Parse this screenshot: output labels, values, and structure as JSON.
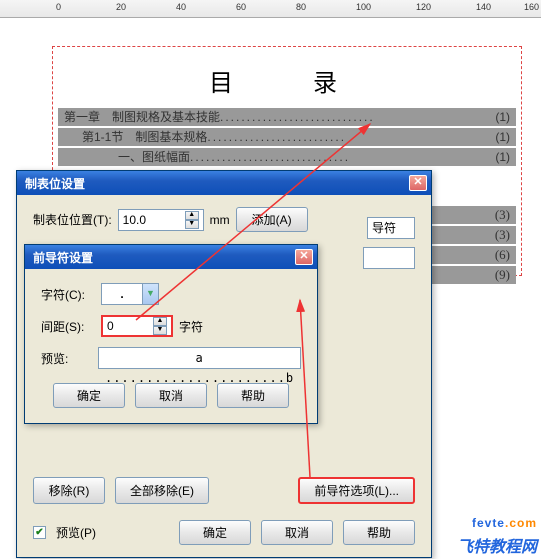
{
  "ruler": {
    "marks": [
      "0",
      "20",
      "40",
      "60",
      "80",
      "100",
      "120",
      "140",
      "160"
    ]
  },
  "doc": {
    "title": "目　录",
    "toc": [
      {
        "label": "第一章　制图规格及基本技能",
        "page": "(1)",
        "indent": 0
      },
      {
        "label": "第1-1节　制图基本规格",
        "page": "(1)",
        "indent": 1
      },
      {
        "label": "一、图纸幅面",
        "page": "(1)",
        "indent": 2
      }
    ],
    "hidden_pages": [
      "(3)",
      "(3)",
      "(6)",
      "(9)"
    ]
  },
  "main_dialog": {
    "title": "制表位设置",
    "pos_label": "制表位位置(T):",
    "pos_value": "10.0",
    "pos_unit": "mm",
    "add_btn": "添加(A)",
    "leader_cut_label": "导符",
    "remove_btn": "移除(R)",
    "remove_all_btn": "全部移除(E)",
    "leader_opts_btn": "前导符选项(L)...",
    "preview_chk": "预览(P)",
    "ok_btn": "确定",
    "cancel_btn": "取消",
    "help_btn": "帮助"
  },
  "sub_dialog": {
    "title": "前导符设置",
    "char_label": "字符(C):",
    "char_value": ".",
    "spacing_label": "间距(S):",
    "spacing_value": "0",
    "spacing_unit": "字符",
    "preview_label": "预览:",
    "preview_text": "a ......................b",
    "ok_btn": "确定",
    "cancel_btn": "取消",
    "help_btn": "帮助"
  },
  "watermark": {
    "line1_a": "fevte",
    "line1_b": ".com",
    "line2": "飞特教程网"
  }
}
